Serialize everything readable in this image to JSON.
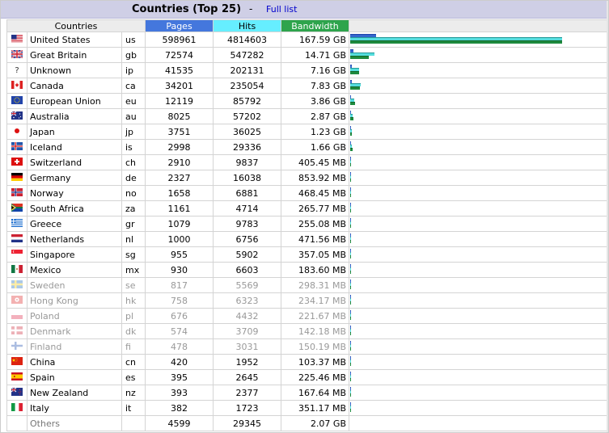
{
  "header": {
    "title": "Countries (Top 25)",
    "separator": "-",
    "full_list": "Full list"
  },
  "columns": {
    "countries": "Countries",
    "pages": "Pages",
    "hits": "Hits",
    "bandwidth": "Bandwidth"
  },
  "colors": {
    "pages": "#4477dd",
    "hits": "#66eeff",
    "bandwidth": "#2ea44c"
  },
  "rows": [
    {
      "flag": "us",
      "name": "United States",
      "code": "us",
      "pages": "598961",
      "hits": "4814603",
      "bandwidth": "167.59 GB",
      "pf": 0.124,
      "hf": 1.0,
      "bf": 1.0
    },
    {
      "flag": "gb",
      "name": "Great Britain",
      "code": "gb",
      "pages": "72574",
      "hits": "547282",
      "bandwidth": "14.71 GB",
      "pf": 0.015,
      "hf": 0.114,
      "bf": 0.088
    },
    {
      "flag": "unknown",
      "name": "Unknown",
      "code": "ip",
      "pages": "41535",
      "hits": "202131",
      "bandwidth": "7.16 GB",
      "pf": 0.009,
      "hf": 0.042,
      "bf": 0.043
    },
    {
      "flag": "ca",
      "name": "Canada",
      "code": "ca",
      "pages": "34201",
      "hits": "235054",
      "bandwidth": "7.83 GB",
      "pf": 0.007,
      "hf": 0.049,
      "bf": 0.047
    },
    {
      "flag": "eu",
      "name": "European Union",
      "code": "eu",
      "pages": "12119",
      "hits": "85792",
      "bandwidth": "3.86 GB",
      "pf": 0.003,
      "hf": 0.018,
      "bf": 0.023
    },
    {
      "flag": "au",
      "name": "Australia",
      "code": "au",
      "pages": "8025",
      "hits": "57202",
      "bandwidth": "2.87 GB",
      "pf": 0.002,
      "hf": 0.012,
      "bf": 0.017
    },
    {
      "flag": "jp",
      "name": "Japan",
      "code": "jp",
      "pages": "3751",
      "hits": "36025",
      "bandwidth": "1.23 GB",
      "pf": 0.001,
      "hf": 0.007,
      "bf": 0.007
    },
    {
      "flag": "is",
      "name": "Iceland",
      "code": "is",
      "pages": "2998",
      "hits": "29336",
      "bandwidth": "1.66 GB",
      "pf": 0.001,
      "hf": 0.006,
      "bf": 0.01
    },
    {
      "flag": "ch",
      "name": "Switzerland",
      "code": "ch",
      "pages": "2910",
      "hits": "9837",
      "bandwidth": "405.45 MB",
      "pf": 0.001,
      "hf": 0.002,
      "bf": 0.002
    },
    {
      "flag": "de",
      "name": "Germany",
      "code": "de",
      "pages": "2327",
      "hits": "16038",
      "bandwidth": "853.92 MB",
      "pf": 0.001,
      "hf": 0.003,
      "bf": 0.005
    },
    {
      "flag": "no",
      "name": "Norway",
      "code": "no",
      "pages": "1658",
      "hits": "6881",
      "bandwidth": "468.45 MB",
      "pf": 0.0,
      "hf": 0.001,
      "bf": 0.003
    },
    {
      "flag": "za",
      "name": "South Africa",
      "code": "za",
      "pages": "1161",
      "hits": "4714",
      "bandwidth": "265.77 MB",
      "pf": 0.0,
      "hf": 0.001,
      "bf": 0.002
    },
    {
      "flag": "gr",
      "name": "Greece",
      "code": "gr",
      "pages": "1079",
      "hits": "9783",
      "bandwidth": "255.08 MB",
      "pf": 0.0,
      "hf": 0.002,
      "bf": 0.001
    },
    {
      "flag": "nl",
      "name": "Netherlands",
      "code": "nl",
      "pages": "1000",
      "hits": "6756",
      "bandwidth": "471.56 MB",
      "pf": 0.0,
      "hf": 0.001,
      "bf": 0.003
    },
    {
      "flag": "sg",
      "name": "Singapore",
      "code": "sg",
      "pages": "955",
      "hits": "5902",
      "bandwidth": "357.05 MB",
      "pf": 0.0,
      "hf": 0.001,
      "bf": 0.002
    },
    {
      "flag": "mx",
      "name": "Mexico",
      "code": "mx",
      "pages": "930",
      "hits": "6603",
      "bandwidth": "183.60 MB",
      "pf": 0.0,
      "hf": 0.001,
      "bf": 0.001
    },
    {
      "flag": "se",
      "name": "Sweden",
      "code": "se",
      "pages": "817",
      "hits": "5569",
      "bandwidth": "298.31 MB",
      "pf": 0.0,
      "hf": 0.001,
      "bf": 0.002,
      "dim": true
    },
    {
      "flag": "hk",
      "name": "Hong Kong",
      "code": "hk",
      "pages": "758",
      "hits": "6323",
      "bandwidth": "234.17 MB",
      "pf": 0.0,
      "hf": 0.001,
      "bf": 0.001,
      "dim": true
    },
    {
      "flag": "pl",
      "name": "Poland",
      "code": "pl",
      "pages": "676",
      "hits": "4432",
      "bandwidth": "221.67 MB",
      "pf": 0.0,
      "hf": 0.001,
      "bf": 0.001,
      "dim": true
    },
    {
      "flag": "dk",
      "name": "Denmark",
      "code": "dk",
      "pages": "574",
      "hits": "3709",
      "bandwidth": "142.18 MB",
      "pf": 0.0,
      "hf": 0.001,
      "bf": 0.001,
      "dim": true
    },
    {
      "flag": "fi",
      "name": "Finland",
      "code": "fi",
      "pages": "478",
      "hits": "3031",
      "bandwidth": "150.19 MB",
      "pf": 0.0,
      "hf": 0.001,
      "bf": 0.001,
      "dim": true
    },
    {
      "flag": "cn",
      "name": "China",
      "code": "cn",
      "pages": "420",
      "hits": "1952",
      "bandwidth": "103.37 MB",
      "pf": 0.0,
      "hf": 0.0,
      "bf": 0.001
    },
    {
      "flag": "es",
      "name": "Spain",
      "code": "es",
      "pages": "395",
      "hits": "2645",
      "bandwidth": "225.46 MB",
      "pf": 0.0,
      "hf": 0.001,
      "bf": 0.001
    },
    {
      "flag": "nz",
      "name": "New Zealand",
      "code": "nz",
      "pages": "393",
      "hits": "2377",
      "bandwidth": "167.64 MB",
      "pf": 0.0,
      "hf": 0.0,
      "bf": 0.001
    },
    {
      "flag": "it",
      "name": "Italy",
      "code": "it",
      "pages": "382",
      "hits": "1723",
      "bandwidth": "351.17 MB",
      "pf": 0.0,
      "hf": 0.0,
      "bf": 0.002
    }
  ],
  "others": {
    "name": "Others",
    "pages": "4599",
    "hits": "29345",
    "bandwidth": "2.07 GB"
  }
}
